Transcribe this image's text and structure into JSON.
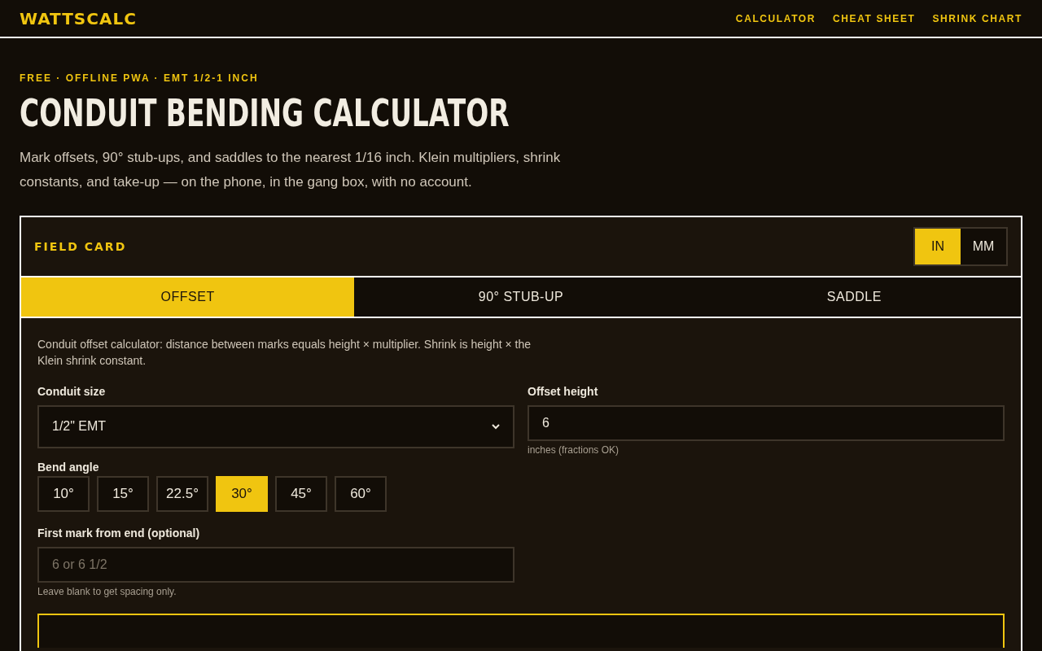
{
  "header": {
    "logo": "WATTSCALC",
    "nav": [
      {
        "label": "CALCULATOR"
      },
      {
        "label": "CHEAT SHEET"
      },
      {
        "label": "SHRINK CHART"
      }
    ]
  },
  "hero": {
    "eyebrow": "FREE · OFFLINE PWA · EMT 1/2-1 INCH",
    "title": "CONDUIT BENDING CALCULATOR",
    "intro": "Mark offsets, 90° stub-ups, and saddles to the nearest 1/16 inch. Klein multipliers, shrink constants, and take-up — on the phone, in the gang box, with no account."
  },
  "card": {
    "title": "FIELD CARD",
    "units": [
      {
        "label": "IN",
        "selected": true
      },
      {
        "label": "MM",
        "selected": false
      }
    ],
    "tabs": [
      {
        "label": "OFFSET",
        "selected": true
      },
      {
        "label": "90° STUB-UP",
        "selected": false
      },
      {
        "label": "SADDLE",
        "selected": false
      }
    ],
    "description": "Conduit offset calculator: distance between marks equals height × multiplier. Shrink is height × the Klein shrink constant.",
    "conduit_size": {
      "label": "Conduit size",
      "value": "1/2\" EMT"
    },
    "offset_height": {
      "label": "Offset height",
      "value": "6",
      "hint": "inches (fractions OK)"
    },
    "bend_angle": {
      "label": "Bend angle",
      "options": [
        {
          "label": "10°",
          "selected": false
        },
        {
          "label": "15°",
          "selected": false
        },
        {
          "label": "22.5°",
          "selected": false
        },
        {
          "label": "30°",
          "selected": true
        },
        {
          "label": "45°",
          "selected": false
        },
        {
          "label": "60°",
          "selected": false
        }
      ]
    },
    "first_mark": {
      "label": "First mark from end (optional)",
      "placeholder": "6 or 6 1/2",
      "hint": "Leave blank to get spacing only."
    }
  }
}
